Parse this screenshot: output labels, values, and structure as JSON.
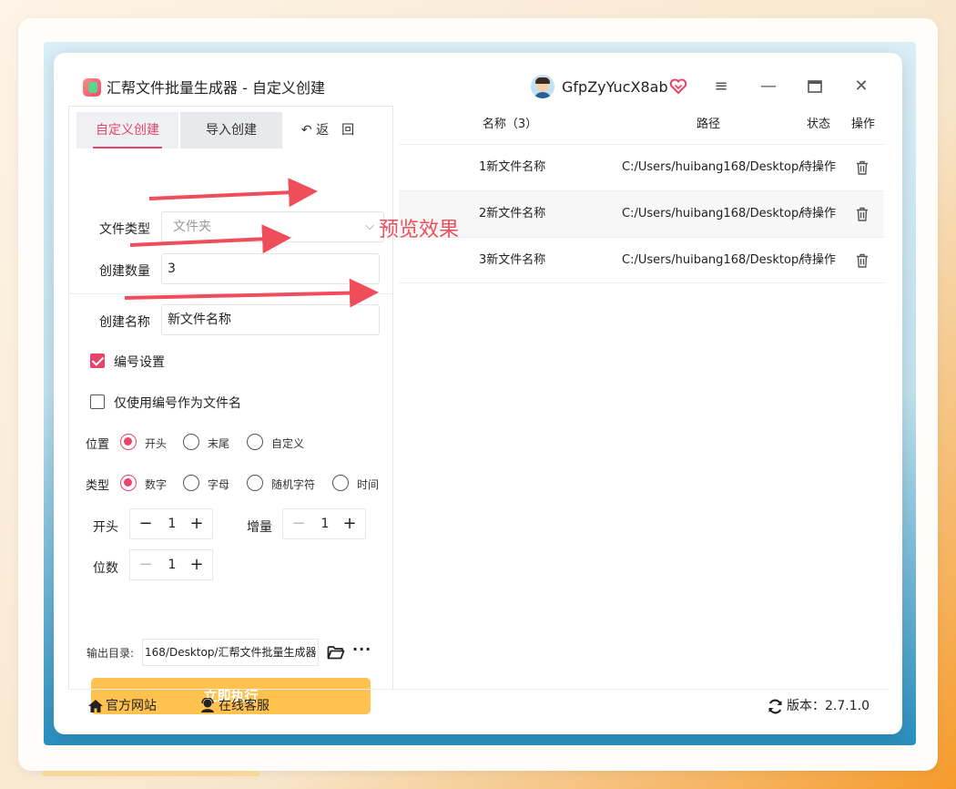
{
  "window": {
    "title": "汇帮文件批量生成器 - 自定义创建",
    "username": "GfpZyYucX8ab"
  },
  "tabs": {
    "custom": "自定义创建",
    "import": "导入创建",
    "back": "↶ 返　回"
  },
  "form": {
    "file_type_label": "文件类型",
    "file_type_value": "文件夹",
    "count_label": "创建数量",
    "count_value": "3",
    "name_label": "创建名称",
    "name_value": "新文件名称",
    "numbering_label": "编号设置",
    "numbering_checked": true,
    "only_number_label": "仅使用编号作为文件名",
    "only_number_checked": false,
    "position_label": "位置",
    "position_options": [
      "开头",
      "末尾",
      "自定义"
    ],
    "position_selected": "开头",
    "type_label": "类型",
    "type_options": [
      "数字",
      "字母",
      "随机字符",
      "时间"
    ],
    "type_selected": "数字",
    "start_label": "开头",
    "start_value": "1",
    "increment_label": "增量",
    "increment_value": "1",
    "digits_label": "位数",
    "digits_value": "1",
    "output_label": "输出目录:",
    "output_value": "168/Desktop/汇帮文件批量生成器",
    "execute_label": "立即执行"
  },
  "table": {
    "headers": {
      "name": "名称（3）",
      "path": "路径",
      "status": "状态",
      "action": "操作"
    },
    "rows": [
      {
        "name": "1新文件名称",
        "path": "C:/Users/huibang168/Desktop/",
        "status": "待操作"
      },
      {
        "name": "2新文件名称",
        "path": "C:/Users/huibang168/Desktop/",
        "status": "待操作"
      },
      {
        "name": "3新文件名称",
        "path": "C:/Users/huibang168/Desktop/",
        "status": "待操作"
      }
    ]
  },
  "footer": {
    "website": "官方网站",
    "support": "在线客服",
    "version": "版本：2.7.1.0"
  },
  "annotation": {
    "text": "预览效果"
  },
  "colors": {
    "accent": "#e9436a",
    "execute": "#ffc24f",
    "annotation": "#f04d5a"
  }
}
